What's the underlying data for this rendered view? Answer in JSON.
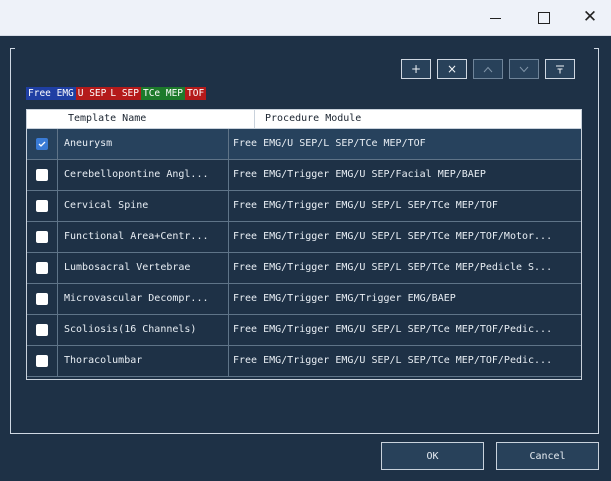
{
  "window": {
    "minimize_icon": "minimize-icon",
    "maximize_icon": "maximize-icon",
    "close_icon": "close-icon",
    "close_glyph": "✕"
  },
  "toolbar": {
    "add": "+",
    "delete": "×",
    "move_up_icon": "chevron-up-icon",
    "move_down_icon": "chevron-down-icon",
    "move_top_icon": "move-to-top-icon"
  },
  "legend": [
    {
      "label": "Free EMG",
      "color": "#1f3fa3"
    },
    {
      "label": "U SEP",
      "color": "#b41a1a"
    },
    {
      "label": "L SEP",
      "color": "#b41a1a"
    },
    {
      "label": "TCe MEP",
      "color": "#1d7a2b"
    },
    {
      "label": "TOF",
      "color": "#b41a1a"
    }
  ],
  "table": {
    "headers": [
      "Template Name",
      "Procedure Module"
    ],
    "rows": [
      {
        "checked": true,
        "name": "Aneurysm",
        "module": "Free EMG/U SEP/L SEP/TCe MEP/TOF"
      },
      {
        "checked": false,
        "name": "Cerebellopontine Angl...",
        "module": "Free EMG/Trigger EMG/U SEP/Facial MEP/BAEP"
      },
      {
        "checked": false,
        "name": "Cervical Spine",
        "module": "Free EMG/Trigger EMG/U SEP/L SEP/TCe MEP/TOF"
      },
      {
        "checked": false,
        "name": "Functional Area+Centr...",
        "module": "Free EMG/Trigger EMG/U SEP/L SEP/TCe MEP/TOF/Motor..."
      },
      {
        "checked": false,
        "name": "Lumbosacral Vertebrae",
        "module": "Free EMG/Trigger EMG/U SEP/L SEP/TCe MEP/Pedicle S..."
      },
      {
        "checked": false,
        "name": "Microvascular Decompr...",
        "module": "Free EMG/Trigger EMG/Trigger EMG/BAEP"
      },
      {
        "checked": false,
        "name": "Scoliosis(16 Channels)",
        "module": "Free EMG/Trigger EMG/U SEP/L SEP/TCe MEP/TOF/Pedic..."
      },
      {
        "checked": false,
        "name": "Thoracolumbar",
        "module": "Free EMG/Trigger EMG/U SEP/L SEP/TCe MEP/TOF/Pedic..."
      }
    ]
  },
  "footer": {
    "ok": "OK",
    "cancel": "Cancel"
  }
}
